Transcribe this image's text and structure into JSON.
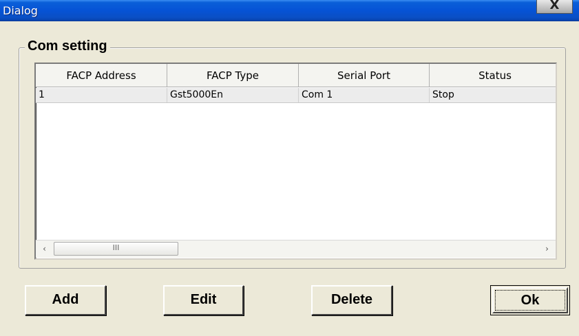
{
  "window": {
    "title": "Dialog",
    "close_label": "X"
  },
  "group": {
    "label": "Com setting"
  },
  "table": {
    "columns": [
      "FACP Address",
      "FACP Type",
      "Serial Port",
      "Status"
    ],
    "rows": [
      [
        "1",
        "Gst5000En",
        "Com 1",
        "Stop"
      ]
    ]
  },
  "scrollbar": {
    "left_arrow": "‹",
    "right_arrow": "›",
    "thumb_grip": "III"
  },
  "buttons": {
    "add": "Add",
    "edit": "Edit",
    "delete": "Delete",
    "ok": "Ok"
  },
  "colors": {
    "titlebar": "#0653d6",
    "dialog_bg": "#ece9d8"
  }
}
